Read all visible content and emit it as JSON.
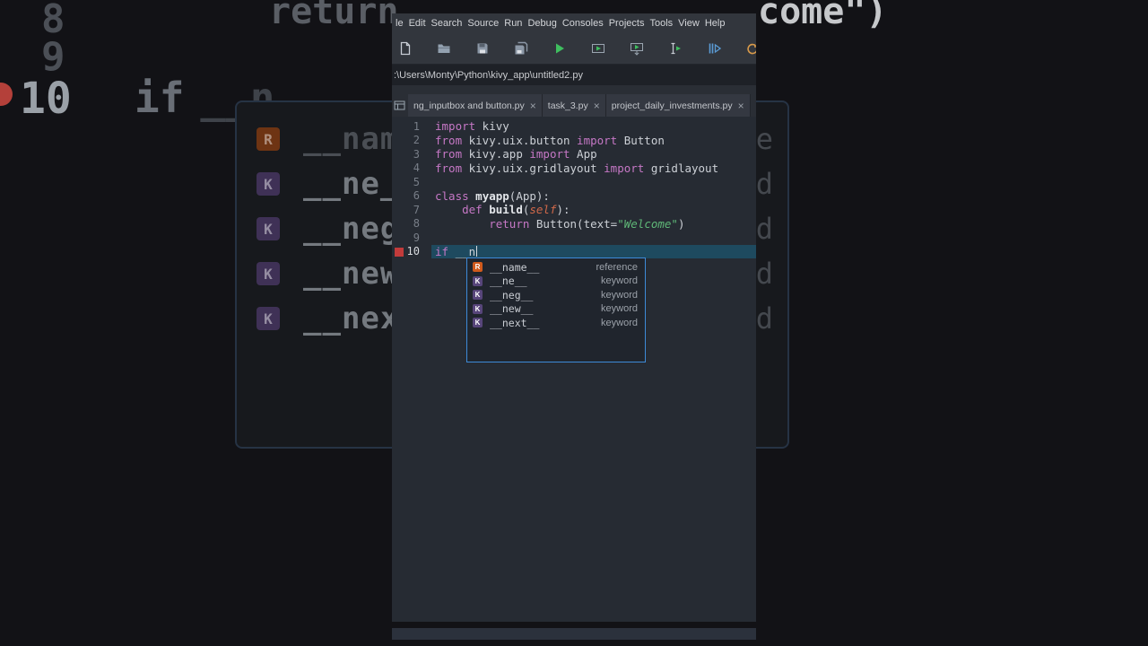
{
  "menubar": {
    "items": [
      "le",
      "Edit",
      "Search",
      "Source",
      "Run",
      "Debug",
      "Consoles",
      "Projects",
      "Tools",
      "View",
      "Help"
    ]
  },
  "toolbar": {
    "items": [
      {
        "name": "new-file"
      },
      {
        "name": "open-folder"
      },
      {
        "name": "save"
      },
      {
        "name": "save-all"
      },
      {
        "name": "run"
      },
      {
        "name": "run-cell"
      },
      {
        "name": "run-cell-advance"
      },
      {
        "name": "run-selection"
      },
      {
        "name": "debug-file"
      },
      {
        "name": "continue"
      }
    ]
  },
  "pathbar": {
    "path": ":\\Users\\Monty\\Python\\kivy_app\\untitled2.py"
  },
  "tabbar": {
    "close_glyph": "×",
    "tabs": [
      {
        "label": "ng_inputbox and button.py"
      },
      {
        "label": "task_3.py"
      },
      {
        "label": "project_daily_investments.py"
      }
    ]
  },
  "editor": {
    "lines": [
      {
        "num": "1",
        "segments": [
          [
            "kw",
            "import"
          ],
          [
            "pl",
            " kivy"
          ]
        ]
      },
      {
        "num": "2",
        "segments": [
          [
            "kw",
            "from"
          ],
          [
            "pl",
            " kivy.uix.button "
          ],
          [
            "kw",
            "import"
          ],
          [
            "pl",
            " Button"
          ]
        ]
      },
      {
        "num": "3",
        "segments": [
          [
            "kw",
            "from"
          ],
          [
            "pl",
            " kivy.app "
          ],
          [
            "kw",
            "import"
          ],
          [
            "pl",
            " App"
          ]
        ]
      },
      {
        "num": "4",
        "segments": [
          [
            "kw",
            "from"
          ],
          [
            "pl",
            " kivy.uix.gridlayout "
          ],
          [
            "kw",
            "import"
          ],
          [
            "pl",
            " gridlayout"
          ]
        ]
      },
      {
        "num": "5",
        "segments": []
      },
      {
        "num": "6",
        "segments": [
          [
            "kw",
            "class"
          ],
          [
            "df",
            " myapp"
          ],
          [
            "pl",
            "(App):"
          ]
        ]
      },
      {
        "num": "7",
        "segments": [
          [
            "pl",
            "    "
          ],
          [
            "kw",
            "def"
          ],
          [
            "df",
            " build"
          ],
          [
            "pl",
            "("
          ],
          [
            "sf",
            "self"
          ],
          [
            "pl",
            "):"
          ]
        ]
      },
      {
        "num": "8",
        "segments": [
          [
            "pl",
            "        "
          ],
          [
            "kw",
            "return"
          ],
          [
            "pl",
            " Button(text="
          ],
          [
            "st",
            "\"Welcome\""
          ],
          [
            "pl",
            ")"
          ]
        ]
      },
      {
        "num": "9",
        "segments": []
      },
      {
        "num": "10",
        "current": true,
        "segments": [
          [
            "kw",
            "if"
          ],
          [
            "pl",
            " __n"
          ]
        ]
      }
    ]
  },
  "completion": {
    "items": [
      {
        "icon": "R",
        "label": "__name__",
        "kind": "reference"
      },
      {
        "icon": "K",
        "label": "__ne__",
        "kind": "keyword"
      },
      {
        "icon": "K",
        "label": "__neg__",
        "kind": "keyword"
      },
      {
        "icon": "K",
        "label": "__new__",
        "kind": "keyword"
      },
      {
        "icon": "K",
        "label": "__next__",
        "kind": "keyword"
      }
    ]
  },
  "background": {
    "top_left": "return",
    "top_right": "come\")",
    "line_numbers": [
      "8",
      "9",
      "10"
    ],
    "current_line": "if __n"
  },
  "colors": {
    "run_green": "#3fbf5f",
    "debug_blue": "#5a9bd4",
    "continue_orange": "#d89a4a",
    "keyword": "#c678c6",
    "string": "#5fb878",
    "self_arg": "#d2694a",
    "popup_border": "#3d8ad8",
    "marker_red": "#c23b3b",
    "icon_reference_bg": "#d05a1c",
    "icon_keyword_bg": "#57457a"
  }
}
